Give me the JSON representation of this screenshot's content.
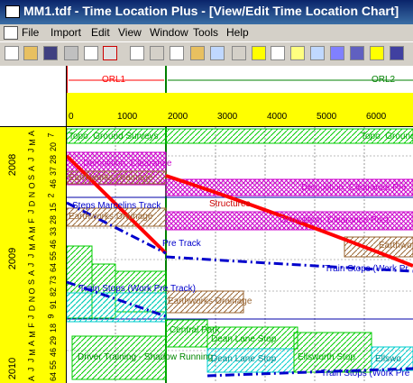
{
  "window": {
    "title": "MM1.tdf - Time Location Plus - [View/Edit Time Location Chart]"
  },
  "menu": [
    "File",
    "Import",
    "Edit",
    "View",
    "Window",
    "Tools",
    "Help"
  ],
  "toolbar_icons": [
    "new-icon",
    "open-icon",
    "save-icon",
    "print-icon",
    "print-preview-icon",
    "export-icon",
    "spell-check-icon",
    "cut-icon",
    "copy-icon",
    "paste-icon",
    "find-icon",
    "undo-icon",
    "help-icon",
    "pointer-icon",
    "edit-icon",
    "zoom-icon",
    "activity-icon",
    "grid-icon",
    "chart-icon",
    "window-icon"
  ],
  "chart": {
    "routes": [
      "ORL1",
      "ORL2"
    ],
    "chainages": [
      "0",
      "1000",
      "2000",
      "3000",
      "4000",
      "5000",
      "6000"
    ],
    "years": [
      "2008",
      "2009",
      "2010"
    ],
    "week_numbers": [
      "7",
      "20",
      "28",
      "37",
      "46",
      "2",
      "15",
      "28",
      "33",
      "46",
      "55",
      "64",
      "73",
      "82",
      "91",
      "9",
      "18",
      "29",
      "46",
      "55",
      "64"
    ],
    "month_letters": [
      "A",
      "M",
      "J",
      "J",
      "A",
      "S",
      "O",
      "N",
      "D",
      "J",
      "F",
      "M",
      "A",
      "M",
      "J",
      "J",
      "A",
      "S",
      "O",
      "N",
      "D",
      "J",
      "F",
      "M",
      "A",
      "M",
      "J",
      "J",
      "A"
    ],
    "activities": [
      "Topo. Ground Surveys",
      "Topo. Ground Surveys",
      "Demolition, Clearance",
      "Earthworks Drainage",
      "Demolition, Clearance Pre",
      "Structures",
      "Earthworks Drainage",
      "Steps Marcelins Track",
      "Pre Track",
      "Demolition, Clearance Post",
      "Earthwo",
      "Train Stops (Work Pr",
      "Train Stops (Work Pre Track)",
      "Earthworks Drainage",
      "Central Park",
      "Dean Lane Stop",
      "Driver Training - Shadow Running",
      "Dean Lane Stop",
      "Ellsworth Stop",
      "Ellswo",
      "Train Stops (Work Pre"
    ],
    "colors": {
      "survey": "#00cc00",
      "demolition": "#cc00cc",
      "earthworks": "#996633",
      "structures": "#ff0000",
      "trainstop": "#0000cc",
      "stop": "#00cccc",
      "band": "#ffff00",
      "route1": "#ff0000",
      "route2": "#008000"
    }
  }
}
